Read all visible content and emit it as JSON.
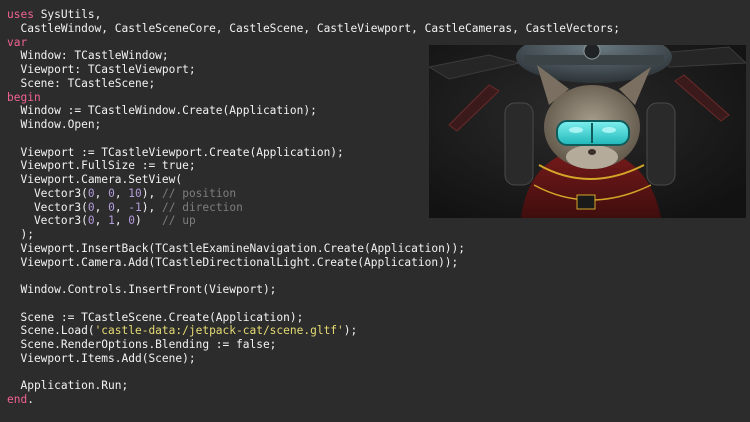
{
  "code": {
    "lines": [
      [
        {
          "t": "uses",
          "c": "kw"
        },
        {
          "t": " SysUtils,"
        }
      ],
      [
        {
          "t": "  CastleWindow, CastleSceneCore, CastleScene, CastleViewport, CastleCameras, CastleVectors;"
        }
      ],
      [
        {
          "t": "var",
          "c": "kw"
        }
      ],
      [
        {
          "t": "  Window: TCastleWindow;"
        }
      ],
      [
        {
          "t": "  Viewport: TCastleViewport;"
        }
      ],
      [
        {
          "t": "  Scene: TCastleScene;"
        }
      ],
      [
        {
          "t": "begin",
          "c": "kw"
        }
      ],
      [
        {
          "t": "  Window := TCastleWindow.Create(Application);"
        }
      ],
      [
        {
          "t": "  Window.Open;"
        }
      ],
      [
        {
          "t": ""
        }
      ],
      [
        {
          "t": "  Viewport := TCastleViewport.Create(Application);"
        }
      ],
      [
        {
          "t": "  Viewport.FullSize := true;"
        }
      ],
      [
        {
          "t": "  Viewport.Camera.SetView("
        }
      ],
      [
        {
          "t": "    Vector3("
        },
        {
          "t": "0",
          "c": "num"
        },
        {
          "t": ", "
        },
        {
          "t": "0",
          "c": "num"
        },
        {
          "t": ", "
        },
        {
          "t": "10",
          "c": "num"
        },
        {
          "t": "), "
        },
        {
          "t": "// position",
          "c": "cm"
        }
      ],
      [
        {
          "t": "    Vector3("
        },
        {
          "t": "0",
          "c": "num"
        },
        {
          "t": ", "
        },
        {
          "t": "0",
          "c": "num"
        },
        {
          "t": ", "
        },
        {
          "t": "-1",
          "c": "num"
        },
        {
          "t": "), "
        },
        {
          "t": "// direction",
          "c": "cm"
        }
      ],
      [
        {
          "t": "    Vector3("
        },
        {
          "t": "0",
          "c": "num"
        },
        {
          "t": ", "
        },
        {
          "t": "1",
          "c": "num"
        },
        {
          "t": ", "
        },
        {
          "t": "0",
          "c": "num"
        },
        {
          "t": ")   "
        },
        {
          "t": "// up",
          "c": "cm"
        }
      ],
      [
        {
          "t": "  );"
        }
      ],
      [
        {
          "t": "  Viewport.InsertBack(TCastleExamineNavigation.Create(Application));"
        }
      ],
      [
        {
          "t": "  Viewport.Camera.Add(TCastleDirectionalLight.Create(Application));"
        }
      ],
      [
        {
          "t": ""
        }
      ],
      [
        {
          "t": "  Window.Controls.InsertFront(Viewport);"
        }
      ],
      [
        {
          "t": ""
        }
      ],
      [
        {
          "t": "  Scene := TCastleScene.Create(Application);"
        }
      ],
      [
        {
          "t": "  Scene.Load("
        },
        {
          "t": "'castle-data:/jetpack-cat/scene.gltf'",
          "c": "str"
        },
        {
          "t": ");"
        }
      ],
      [
        {
          "t": "  Scene.RenderOptions.Blending := false;"
        }
      ],
      [
        {
          "t": "  Viewport.Items.Add(Scene);"
        }
      ],
      [
        {
          "t": ""
        }
      ],
      [
        {
          "t": "  Application.Run;"
        }
      ],
      [
        {
          "t": "end",
          "c": "kw"
        },
        {
          "t": "."
        }
      ]
    ]
  },
  "viewport": {
    "scene": "jetpack-cat-render"
  },
  "colors": {
    "background": "#2c2c2c",
    "text": "#f2f2f2",
    "keyword": "#f06292",
    "number": "#b39ddb",
    "string": "#e6db74",
    "comment": "#7d7d7d"
  }
}
